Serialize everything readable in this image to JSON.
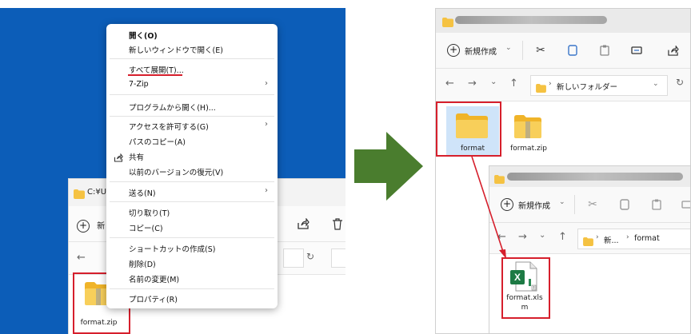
{
  "left": {
    "window_title": "C:¥Us",
    "toolbar_new": "新",
    "file_label": "format.zip",
    "context_menu": {
      "items": [
        {
          "label": "開く(O)",
          "bold": true,
          "chevron": false
        },
        {
          "label": "新しいウィンドウで開く(E)",
          "chevron": false
        },
        {
          "label": "すべて展開(T)...",
          "chevron": false,
          "underlined": true
        },
        {
          "label": "7-Zip",
          "chevron": true
        },
        {
          "label": "プログラムから開く(H)...",
          "chevron": false
        },
        {
          "label": "アクセスを許可する(G)",
          "chevron": true
        },
        {
          "label": "パスのコピー(A)",
          "chevron": false
        },
        {
          "label": "共有",
          "chevron": false,
          "icon": "share-icon"
        },
        {
          "label": "以前のバージョンの復元(V)",
          "chevron": false
        },
        {
          "label": "送る(N)",
          "chevron": true
        },
        {
          "label": "切り取り(T)",
          "chevron": false
        },
        {
          "label": "コピー(C)",
          "chevron": false
        },
        {
          "label": "ショートカットの作成(S)",
          "chevron": false
        },
        {
          "label": "削除(D)",
          "chevron": false
        },
        {
          "label": "名前の変更(M)",
          "chevron": false
        },
        {
          "label": "プロパティ(R)",
          "chevron": false
        }
      ],
      "chevron_glyph": "›"
    }
  },
  "right": {
    "top_window": {
      "new_button": "新規作成",
      "breadcrumb": "新しいフォルダー",
      "files": [
        {
          "label": "format",
          "kind": "folder"
        },
        {
          "label": "format.zip",
          "kind": "zip-folder"
        }
      ]
    },
    "inner_window": {
      "new_button": "新規作成",
      "breadcrumb_1": "新...",
      "breadcrumb_2": "format",
      "file_label_line1": "format.xls",
      "file_label_line2": "m"
    }
  },
  "colors": {
    "desktop_blue": "#0c5db8",
    "highlight_red": "#d61f2c",
    "arrow_green": "#4a7d2e",
    "folder_yellow": "#f5c242"
  }
}
